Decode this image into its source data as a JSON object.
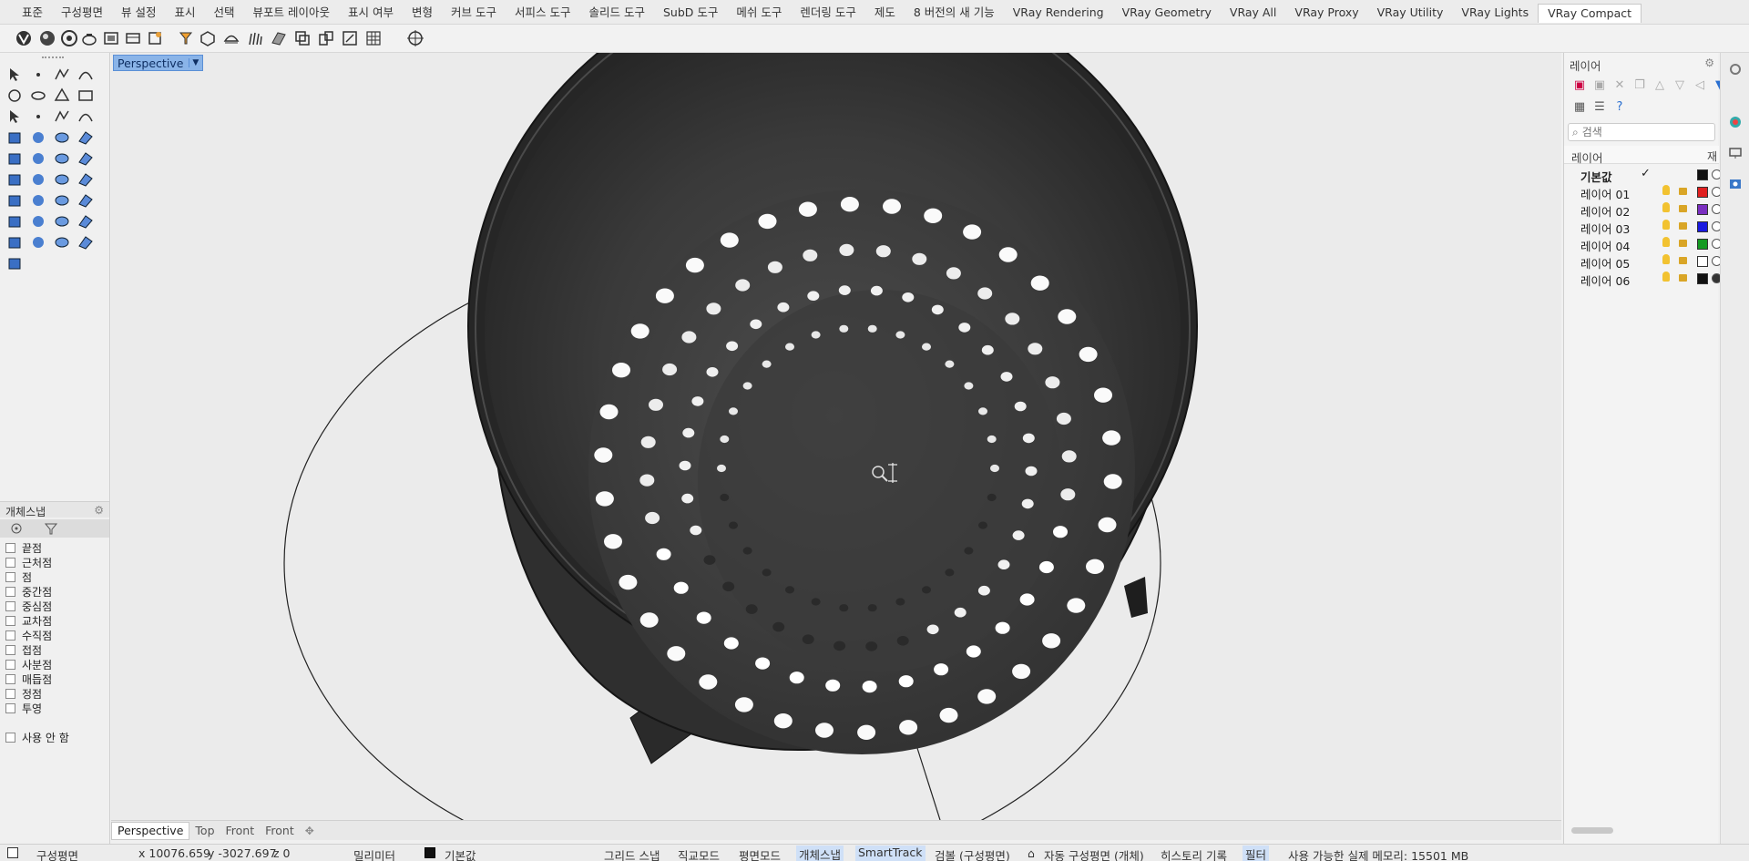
{
  "tabs": [
    "표준",
    "구성평면",
    "뷰 설정",
    "표시",
    "선택",
    "뷰포트 레이아웃",
    "표시 여부",
    "변형",
    "커브 도구",
    "서피스 도구",
    "솔리드 도구",
    "SubD 도구",
    "메쉬 도구",
    "렌더링 도구",
    "제도",
    "8 버전의 새 기능",
    "VRay Rendering",
    "VRay Geometry",
    "VRay All",
    "VRay Proxy",
    "VRay Utility",
    "VRay Lights",
    "VRay Compact"
  ],
  "active_tab": "VRay Compact",
  "viewport": {
    "label": "Perspective",
    "tabs": [
      "Perspective",
      "Top",
      "Front",
      "Front"
    ],
    "add_icon": "plus-icon"
  },
  "osnap": {
    "title": "개체스냅",
    "items": [
      "끝점",
      "근처점",
      "점",
      "중간점",
      "중심점",
      "교차점",
      "수직점",
      "접점",
      "사분점",
      "매듭점",
      "정점",
      "투영"
    ],
    "disable": "사용 안 함"
  },
  "layers": {
    "title": "레이어",
    "search_placeholder": "검색",
    "header_name": "레이어",
    "header_mat": "재",
    "rows": [
      {
        "name": "기본값",
        "current": true,
        "color": "#111111"
      },
      {
        "name": "레이어 01",
        "current": false,
        "color": "#e02020"
      },
      {
        "name": "레이어 02",
        "current": false,
        "color": "#7a2fc0"
      },
      {
        "name": "레이어 03",
        "current": false,
        "color": "#1a1ae0"
      },
      {
        "name": "레이어 04",
        "current": false,
        "color": "#159a22"
      },
      {
        "name": "레이어 05",
        "current": false,
        "color": "#ffffff"
      },
      {
        "name": "레이어 06",
        "current": false,
        "color": "#111111"
      }
    ]
  },
  "status": {
    "cplane": "구성평면",
    "x": "x 10076.659",
    "y": "y -3027.697",
    "z": "z 0",
    "units": "밀리미터",
    "layer": "기본값",
    "grid_snap": "그리드 스냅",
    "ortho": "직교모드",
    "planar": "평면모드",
    "osnap": "개체스냅",
    "smarttrack": "SmartTrack",
    "gumball": "검볼 (구성평면)",
    "auto_cplane": "자동 구성평면 (개체)",
    "history": "히스토리 기록",
    "filter": "필터",
    "memory": "사용 가능한 실제 메모리: 15501 MB"
  }
}
